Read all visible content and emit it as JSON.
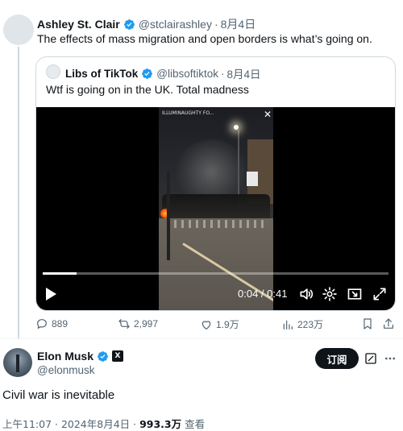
{
  "retweet_context": {
    "author_name": "Ashley St. Clair",
    "handle": "@stclairashley",
    "date": "8月4日",
    "text": "The effects of mass migration and open borders is what’s going on.",
    "quote": {
      "author_name": "Libs of TikTok",
      "handle": "@libsoftiktok",
      "date": "8月4日",
      "text": "Wtf is going on in the UK. Total madness",
      "video": {
        "overlay_text": "ILLUMINAUGHTY FO...",
        "time_display": "0:04 / 0:41",
        "progress_fraction": 0.098,
        "controls": [
          "play-icon",
          "volume-icon",
          "settings-icon",
          "pip-icon",
          "fullscreen-icon",
          "close-icon"
        ]
      }
    },
    "actions": {
      "replies": "889",
      "reposts": "2,997",
      "likes": "1.9万",
      "views": "223万"
    }
  },
  "main_tweet": {
    "author_name": "Elon Musk",
    "handle": "@elonmusk",
    "subscribe_label": "订阅",
    "text": "Civil war is inevitable",
    "timestamp": "上午11:07 · 2024年8月4日 ·",
    "views_count": "993.3万",
    "views_label": "查看"
  },
  "colors": {
    "verified_blue": "#1d9bf0",
    "text_primary": "#0f1419",
    "text_secondary": "#536471",
    "border": "#cfd9de"
  }
}
